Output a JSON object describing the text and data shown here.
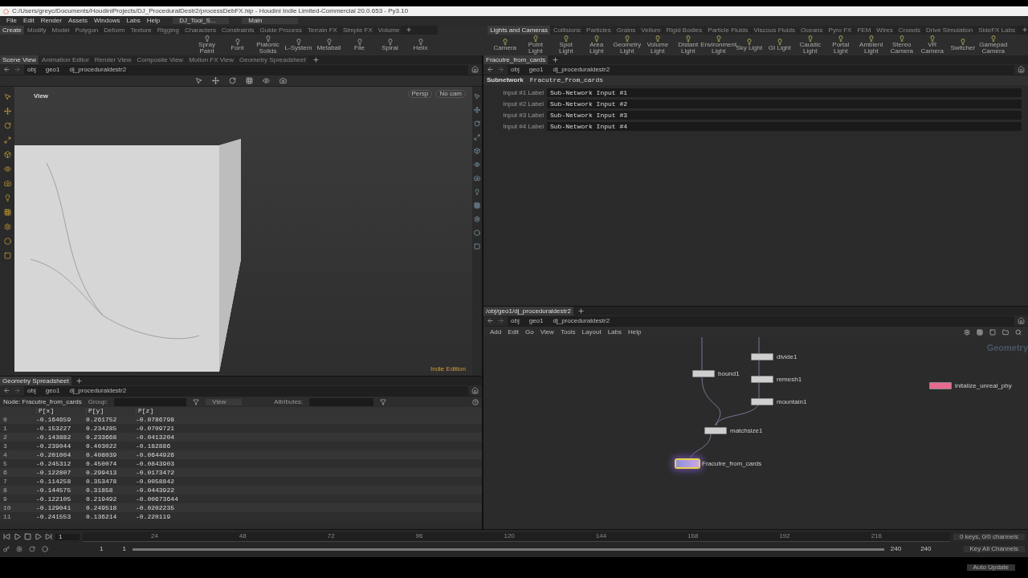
{
  "window": {
    "title": "C:/Users/greyc/Documents/HoudiniProjects/DJ_ProceduralDestr2/processDebFX.hip - Houdini Indie Limited-Commercial 20.0.653 - Py3.10"
  },
  "menu": [
    "File",
    "Edit",
    "Render",
    "Assets",
    "Windows",
    "Labs",
    "Help"
  ],
  "desktops": [
    {
      "label": "DJ_Tool_S..."
    },
    {
      "label": "Main"
    }
  ],
  "shelf_left": {
    "tabs": [
      {
        "label": "Create",
        "selected": true
      },
      {
        "label": "Modify",
        "selected": false
      },
      {
        "label": "Model",
        "selected": false
      },
      {
        "label": "Polygon",
        "selected": false
      },
      {
        "label": "Deform",
        "selected": false
      },
      {
        "label": "Texture",
        "selected": false
      },
      {
        "label": "Rigging",
        "selected": false
      },
      {
        "label": "Characters",
        "selected": false
      },
      {
        "label": "Constraints",
        "selected": false
      },
      {
        "label": "Guide Process",
        "selected": false
      },
      {
        "label": "Terrain FX",
        "selected": false
      },
      {
        "label": "Simple FX",
        "selected": false
      },
      {
        "label": "Volume",
        "selected": false
      }
    ],
    "tools": [
      "Spray Paint",
      "Font",
      "Platonic Solids",
      "L-System",
      "Metaball",
      "File",
      "Spiral",
      "Helix"
    ]
  },
  "shelf_right": {
    "tabs": [
      {
        "label": "Lights and Cameras",
        "selected": true
      },
      {
        "label": "Collisions",
        "selected": false
      },
      {
        "label": "Particles",
        "selected": false
      },
      {
        "label": "Grains",
        "selected": false
      },
      {
        "label": "Vellum",
        "selected": false
      },
      {
        "label": "Rigid Bodies",
        "selected": false
      },
      {
        "label": "Particle Fluids",
        "selected": false
      },
      {
        "label": "Viscous Fluids",
        "selected": false
      },
      {
        "label": "Oceans",
        "selected": false
      },
      {
        "label": "Pyro FX",
        "selected": false
      },
      {
        "label": "FEM",
        "selected": false
      },
      {
        "label": "Wires",
        "selected": false
      },
      {
        "label": "Crowds",
        "selected": false
      },
      {
        "label": "Drive Simulation",
        "selected": false
      },
      {
        "label": "SideFX Labs",
        "selected": false
      }
    ],
    "tools": [
      "Camera",
      "Point Light",
      "Spot Light",
      "Area Light",
      "Geometry Light",
      "Volume Light",
      "Distant Light",
      "Environment Light",
      "Sky Light",
      "GI Light",
      "Caustic Light",
      "Portal Light",
      "Ambient Light",
      "Stereo Camera",
      "VR Camera",
      "Switcher",
      "Gamepad Camera"
    ]
  },
  "scene_view": {
    "tabs": [
      {
        "label": "Scene View",
        "selected": true
      },
      {
        "label": "Animation Editor",
        "selected": false
      },
      {
        "label": "Render View",
        "selected": false
      },
      {
        "label": "Composite View",
        "selected": false
      },
      {
        "label": "Motion FX View",
        "selected": false
      },
      {
        "label": "Geometry Spreadsheet",
        "selected": false
      }
    ],
    "path": [
      "obj",
      "geo1",
      "dj_proceduraldestr2"
    ],
    "viewport_label": "View",
    "camera_menu": "Persp",
    "cam_menu": "No cam",
    "edition": "Indie Edition"
  },
  "parameters": {
    "tab": "Fracutre_from_cards",
    "path": [
      "obj",
      "geo1",
      "dj_proceduraldestr2"
    ],
    "node_type": "Subnetwork",
    "node_name": "Fracutre_from_cards",
    "fields": [
      {
        "label": "Input #1 Label",
        "value": "Sub-Network Input #1"
      },
      {
        "label": "Input #2 Label",
        "value": "Sub-Network Input #2"
      },
      {
        "label": "Input #3 Label",
        "value": "Sub-Network Input #3"
      },
      {
        "label": "Input #4 Label",
        "value": "Sub-Network Input #4"
      }
    ]
  },
  "spreadsheet": {
    "tab": "Geometry Spreadsheet",
    "path": [
      "obj",
      "geo1",
      "dj_proceduraldestr2"
    ],
    "node": "Node: Fracutre_from_cards",
    "group_label": "Group:",
    "view_menu": "View",
    "attributes_label": "Attributes:",
    "columns": [
      "",
      "P[x]",
      "P[y]",
      "P[z]"
    ],
    "rows": [
      [
        "0",
        "-0.164659",
        "0.261752",
        "-0.0786798"
      ],
      [
        "1",
        "-0.153227",
        "0.234285",
        "-0.0709721"
      ],
      [
        "2",
        "-0.143882",
        "0.233668",
        "-0.0413204"
      ],
      [
        "3",
        "-0.239044",
        "0.403022",
        "-0.182886"
      ],
      [
        "4",
        "-0.201004",
        "0.408039",
        "-0.0644926"
      ],
      [
        "5",
        "-0.245312",
        "0.450074",
        "-0.0843903"
      ],
      [
        "6",
        "-0.122807",
        "0.299413",
        "-0.0173472"
      ],
      [
        "7",
        "-0.114258",
        "0.353478",
        "-0.0058842"
      ],
      [
        "8",
        "-0.144575",
        "0.31858",
        "-0.0443922"
      ],
      [
        "9",
        "-0.122105",
        "0.219492",
        "-0.00673644"
      ],
      [
        "10",
        "-0.129041",
        "0.249518",
        "-0.0202235"
      ],
      [
        "11",
        "-0.241553",
        "0.136214",
        "-0.220119"
      ]
    ]
  },
  "network": {
    "tab": "/obj/geo1/dj_proceduraldestr2",
    "path": [
      "obj",
      "geo1",
      "dj_proceduraldestr2"
    ],
    "menu": [
      "Add",
      "Edit",
      "Go",
      "View",
      "Tools",
      "Layout",
      "Labs",
      "Help"
    ],
    "context_label": "Geometry",
    "nodes": [
      {
        "name": "divide1",
        "kind": "plain",
        "selected": false
      },
      {
        "name": "bound1",
        "kind": "plain",
        "selected": false
      },
      {
        "name": "remesh1",
        "kind": "plain",
        "selected": false
      },
      {
        "name": "mountain1",
        "kind": "plain",
        "selected": false
      },
      {
        "name": "matchsize1",
        "kind": "plain",
        "selected": false
      },
      {
        "name": "Fracutre_from_cards",
        "kind": "subnet",
        "selected": true
      },
      {
        "name": "initalize_unreal_phy",
        "kind": "hda",
        "selected": false
      }
    ]
  },
  "timeline": {
    "frame": "1",
    "ticks": [
      "24",
      "48",
      "72",
      "96",
      "120",
      "144",
      "168",
      "192",
      "216"
    ],
    "start": "1",
    "range_start": "1",
    "range_end": "240",
    "range": {
      "level": 1
    },
    "end": "240",
    "keys_info": "0 keys, 0/0 channels",
    "key_button": "Key All Channels",
    "update_button": "Auto Update"
  }
}
